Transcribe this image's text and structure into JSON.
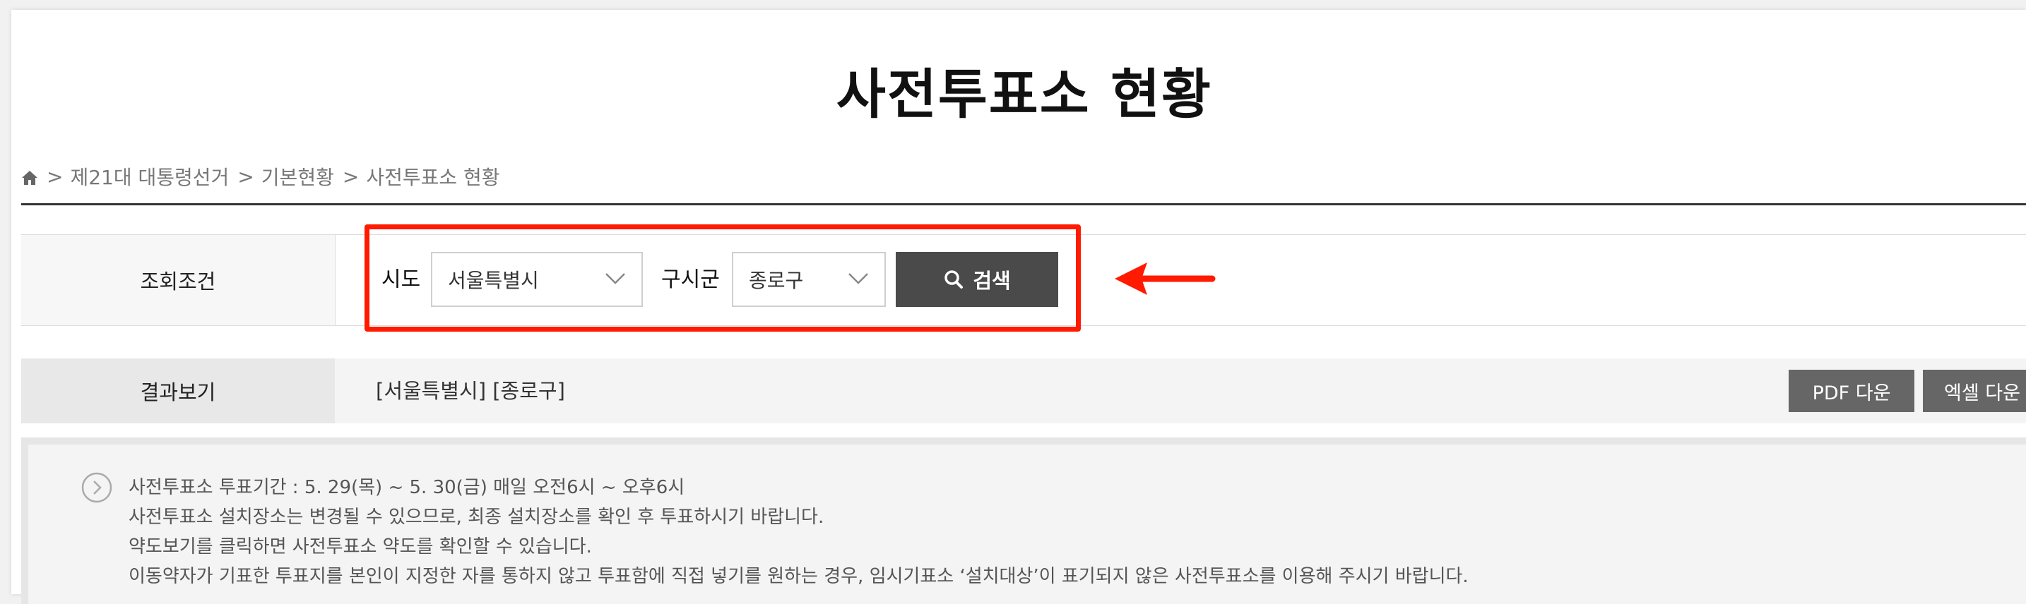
{
  "page": {
    "title": "사전투표소 현황"
  },
  "breadcrumb": {
    "home_icon": "home-icon",
    "separator": ">",
    "items": [
      "제21대 대통령선거",
      "기본현황",
      "사전투표소 현황"
    ]
  },
  "search": {
    "label": "조회조건",
    "sido_label": "시도",
    "sido_value": "서울특별시",
    "gusigun_label": "구시군",
    "gusigun_value": "종로구",
    "button_label": "검색",
    "button_icon": "search-icon"
  },
  "result": {
    "label": "결과보기",
    "text": "[서울특별시] [종로구]",
    "pdf_button": "PDF 다운",
    "excel_button": "엑셀 다운"
  },
  "notice": {
    "icon": "chevron-right-circle-icon",
    "lines": [
      "사전투표소 투표기간 : 5. 29(목) ~ 5. 30(금) 매일 오전6시 ~ 오후6시",
      "사전투표소 설치장소는 변경될 수 있으므로, 최종 설치장소를 확인 후 투표하시기 바랍니다.",
      "약도보기를 클릭하면 사전투표소 약도를 확인할 수 있습니다.",
      "이동약자가 기표한 투표지를 본인이 지정한 자를 통하지 않고 투표함에 직접 넣기를 원하는 경우, 임시기표소 ‘설치대상’이 표기되지 않은 사전투표소를 이용해 주시기 바랍니다."
    ]
  },
  "colors": {
    "annotation": "#ff1a00",
    "search_button": "#4a4a4a",
    "download_button": "#666666"
  }
}
